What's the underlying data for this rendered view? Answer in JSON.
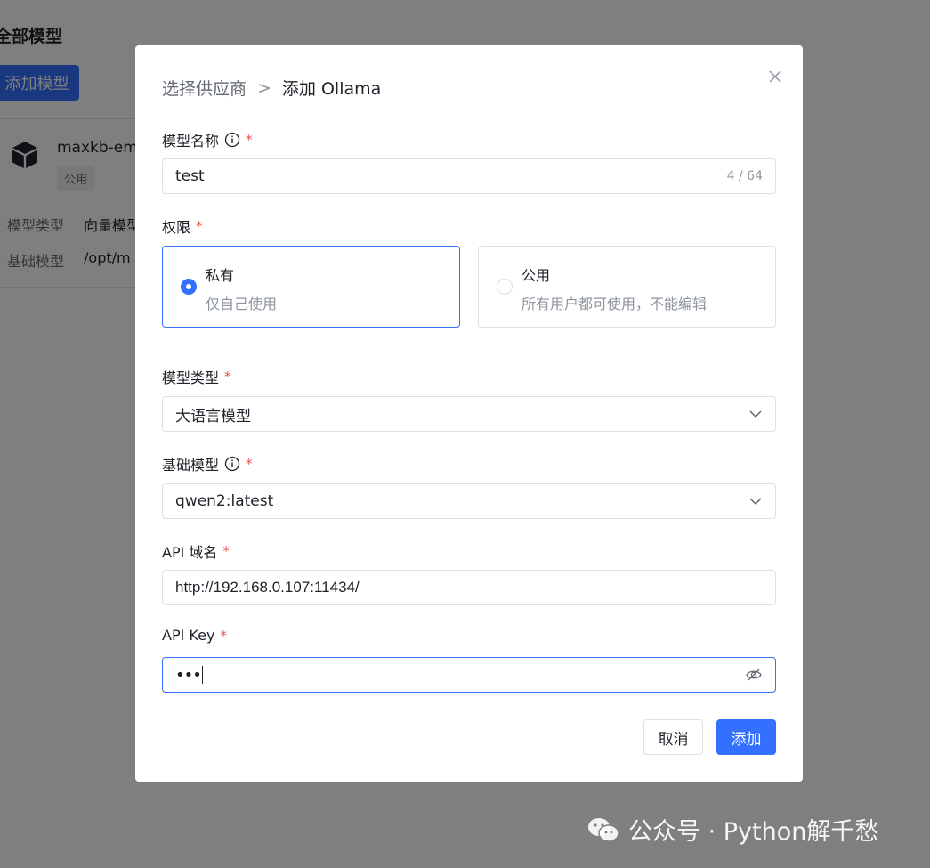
{
  "background": {
    "title": "全部模型",
    "add_button": "添加模型",
    "card": {
      "name": "maxkb-em",
      "badge": "公用",
      "rows": [
        {
          "label": "模型类型",
          "value": "向量模型"
        },
        {
          "label": "基础模型",
          "value": "/opt/m"
        }
      ]
    }
  },
  "dialog": {
    "breadcrumb": {
      "prev": "选择供应商",
      "sep": ">",
      "current": "添加 Ollama"
    },
    "model_name": {
      "label": "模型名称",
      "required": "*",
      "value": "test",
      "count": "4 / 64"
    },
    "permission": {
      "label": "权限",
      "required": "*",
      "options": [
        {
          "title": "私有",
          "desc": "仅自己使用",
          "selected": true
        },
        {
          "title": "公用",
          "desc": "所有用户都可使用，不能编辑",
          "selected": false
        }
      ]
    },
    "model_type": {
      "label": "模型类型",
      "required": "*",
      "value": "大语言模型"
    },
    "base_model": {
      "label": "基础模型",
      "required": "*",
      "value": "qwen2:latest"
    },
    "api_domain": {
      "label": "API 域名",
      "required": "*",
      "value": "http://192.168.0.107:11434/"
    },
    "api_key": {
      "label": "API Key",
      "required": "*",
      "value": "•••"
    },
    "buttons": {
      "cancel": "取消",
      "add": "添加"
    }
  },
  "watermark": {
    "text": "公众号 · Python解千愁"
  },
  "colors": {
    "primary": "#3370ff",
    "required": "#f54a45",
    "overlay": "rgba(0,0,0,0.5)"
  }
}
